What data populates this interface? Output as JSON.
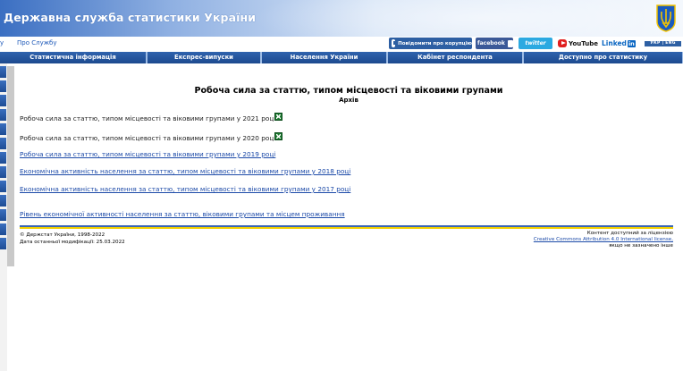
{
  "header": {
    "title": "Державна служба статистики України"
  },
  "subnav": {
    "link_partial": "у",
    "about": "Про Службу"
  },
  "social": {
    "corruption": "Повідомити про корупцію",
    "facebook": "facebook",
    "twitter": "twitter",
    "youtube": "YouTube",
    "linkedin_text": "Linked",
    "linkedin_in": "in",
    "lang": "УКР | ENG"
  },
  "nav": {
    "items": [
      "Статистична інформація",
      "Експрес-випуски",
      "Населення України",
      "Кабінет респондента",
      "Доступно про статистику"
    ]
  },
  "main": {
    "title": "Робоча сила за статтю, типом місцевості та віковими групами",
    "subtitle": "Архів",
    "entries": [
      "Робоча сила за статтю, типом місцевості та віковими групами у 2021 році",
      "Робоча сила за статтю, типом місцевості та віковими групами у 2020 році",
      "Робоча сила за статтю, типом місцевості та віковими групами у 2019 році",
      "Економічна активність населення за статтю, типом місцевості та віковими групами у 2018 році",
      "Економічна активність населення за статтю, типом місцевості та віковими групами у 2017 році",
      "Рівень економічної активності населення за статтю, віковими групами та місцем проживання"
    ]
  },
  "footer": {
    "copyright": "© Держстат України, 1998-2022",
    "modified": "Дата останньої модифікації: 25.03.2022",
    "license_line1": "Контент доступний за ліцензією",
    "license_link": "Creative Commons Attribution 4.0 International license,",
    "license_line3": "якщо не зазначено інше"
  },
  "colors": {
    "nav_blue": "#1d4a8f",
    "link_blue": "#1c4aa8",
    "excel_green": "#1e7a32",
    "flag_yellow": "#f2d000"
  }
}
